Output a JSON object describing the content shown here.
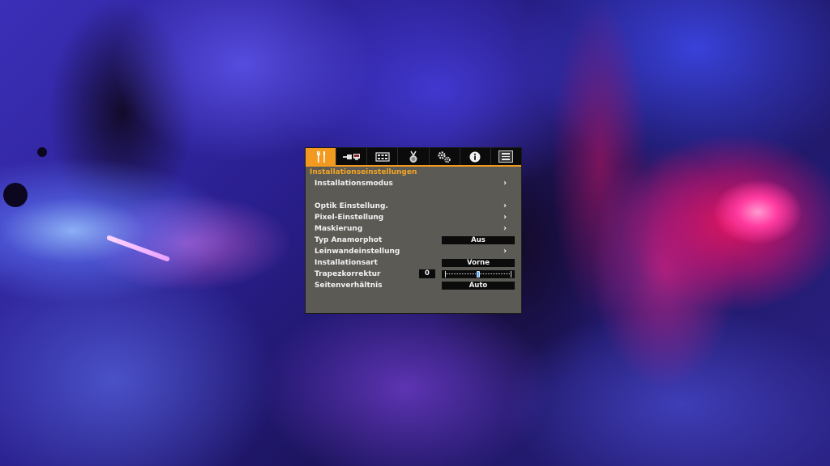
{
  "osd": {
    "tabs": [
      {
        "icon": "wrench-screwdriver-icon",
        "active": true
      },
      {
        "icon": "input-connector-icon",
        "active": false
      },
      {
        "icon": "display-grid-icon",
        "active": false
      },
      {
        "icon": "medal-icon",
        "active": false
      },
      {
        "icon": "gears-icon",
        "active": false
      },
      {
        "icon": "info-icon",
        "active": false
      },
      {
        "icon": "menu-icon",
        "active": false
      }
    ],
    "section_title": "Installationseinstellungen",
    "rows": {
      "installationsmodus": {
        "label": "Installationsmodus",
        "chevron": "›"
      },
      "optik": {
        "label": "Optik Einstellung.",
        "chevron": "›"
      },
      "pixel": {
        "label": "Pixel-Einstellung",
        "chevron": "›"
      },
      "maskierung": {
        "label": "Maskierung",
        "chevron": "›"
      },
      "anamorphot": {
        "label": "Typ Anamorphot",
        "value": "Aus"
      },
      "leinwand": {
        "label": "Leinwandeinstellung",
        "chevron": "›"
      },
      "installationsart": {
        "label": "Installationsart",
        "value": "Vorne"
      },
      "trapez": {
        "label": "Trapezkorrektur",
        "value": "0",
        "slider_position": 0.5
      },
      "seitenverhaeltnis": {
        "label": "Seitenverhältnis",
        "value": "Auto"
      }
    }
  },
  "colors": {
    "accent": "#f29a1f",
    "panel": "#5b5a54",
    "tabbar": "#0b0b0b",
    "value_box": "#0b0b0b",
    "slider_thumb": "#5aa9ff"
  }
}
